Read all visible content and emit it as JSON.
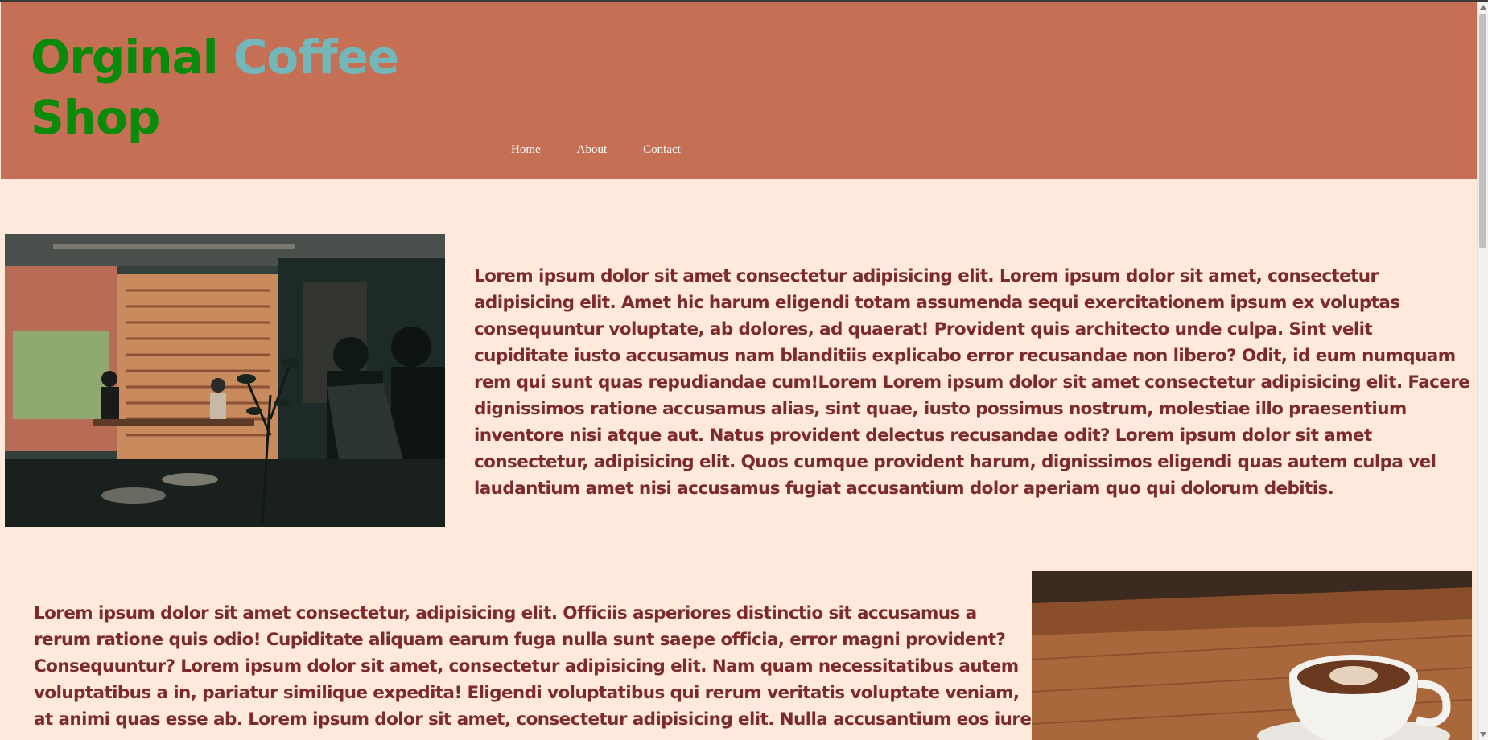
{
  "header": {
    "logo": {
      "word1": "Orginal",
      "word2": "Coffee",
      "word3": "Shop"
    },
    "nav": [
      {
        "label": "Home"
      },
      {
        "label": "About"
      },
      {
        "label": "Contact"
      }
    ]
  },
  "sections": [
    {
      "text": "Lorem ipsum dolor sit amet consectetur adipisicing elit. Lorem ipsum dolor sit amet, consectetur adipisicing elit. Amet hic harum eligendi totam assumenda sequi exercitationem ipsum ex voluptas consequuntur voluptate, ab dolores, ad quaerat! Provident quis architecto unde culpa. Sint velit cupiditate iusto accusamus nam blanditiis explicabo error recusandae non libero? Odit, id eum numquam rem qui sunt quas repudiandae cum!Lorem Lorem ipsum dolor sit amet consectetur adipisicing elit. Facere dignissimos ratione accusamus alias, sint quae, iusto possimus nostrum, molestiae illo praesentium inventore nisi atque aut. Natus provident delectus recusandae odit? Lorem ipsum dolor sit amet consectetur, adipisicing elit. Quos cumque provident harum, dignissimos eligendi quas autem culpa vel laudantium amet nisi accusamus fugiat accusantium dolor aperiam quo qui dolorum debitis."
    },
    {
      "text": "Lorem ipsum dolor sit amet consectetur, adipisicing elit. Officiis asperiores distinctio sit accusamus a rerum ratione quis odio! Cupiditate aliquam earum fuga nulla sunt saepe officia, error magni provident? Consequuntur? Lorem ipsum dolor sit amet, consectetur adipisicing elit. Nam quam necessitatibus autem voluptatibus a in, pariatur similique expedita! Eligendi voluptatibus qui rerum veritatis voluptate veniam, at animi quas esse ab. Lorem ipsum dolor sit amet, consectetur adipisicing elit. Nulla accusantium eos iure"
    }
  ],
  "colors": {
    "page_background": "#fee9dc",
    "header_background": "#c56f55",
    "logo_green": "#0a8a0a",
    "logo_teal": "#72b8bb",
    "body_text": "#7c2a2a"
  }
}
